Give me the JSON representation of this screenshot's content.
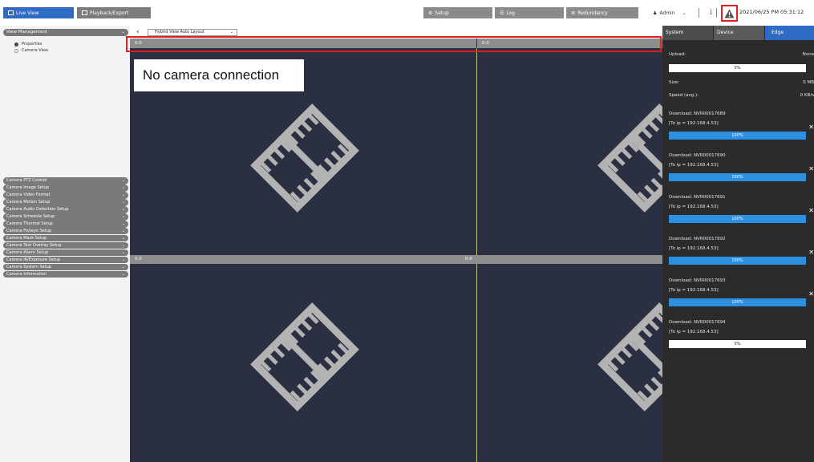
{
  "topbar": {
    "live_view": "Live View",
    "playback": "Playback/Export",
    "setup": "Setup",
    "log": "Log",
    "redundancy": "Redundancy",
    "admin": "Admin",
    "datetime": "2021/06/25 PM 05:31:12"
  },
  "sidebar": {
    "header": "View Management",
    "radios": [
      {
        "label": "Properties",
        "selected": true
      },
      {
        "label": "Camera View",
        "selected": false
      }
    ],
    "menu": [
      "Camera PTZ Control",
      "Camera Image Setup",
      "Camera Video Format",
      "Camera Motion Setup",
      "Camera Audio Detection Setup",
      "Camera Schedule Setup",
      "Camera Thermal Setup",
      "Camera Fisheye Setup",
      "Camera Mask Setup",
      "Camera Text Overlay Setup",
      "Camera Alarm Setup",
      "Camera IR/Exposure Setup",
      "Camera System Setup",
      "Camera Information"
    ]
  },
  "layout": {
    "selected": "Hybrid View Auto Layout"
  },
  "grid": {
    "cam1_title": "0.0",
    "cam2_title": "0.0",
    "cam3_title": "0.0",
    "cam4_title": "0.0",
    "no_connection": "No camera connection"
  },
  "right_panel": {
    "tabs": {
      "system": "System",
      "device": "Device",
      "edge": "Edge"
    },
    "upload_label": "Upload:",
    "upload_value": "None",
    "upload_progress": {
      "percent": 0,
      "text": "0%"
    },
    "size_label": "Size:",
    "size_value": "0 MB",
    "speed_label": "Speed (avg.):",
    "speed_value": "0 KB/s",
    "downloads": [
      {
        "title": "Download: NVR00017689",
        "ip": "[To ip = 192.168.4.53]",
        "percent": 100,
        "text": "100%"
      },
      {
        "title": "Download: NVR00017690",
        "ip": "[To ip = 192.168.4.53]",
        "percent": 100,
        "text": "100%"
      },
      {
        "title": "Download: NVR00017691",
        "ip": "[To ip = 192.168.4.53]",
        "percent": 100,
        "text": "100%"
      },
      {
        "title": "Download: NVR00017692",
        "ip": "[To ip = 192.168.4.53]",
        "percent": 100,
        "text": "100%"
      },
      {
        "title": "Download: NVR00017693",
        "ip": "[To ip = 192.168.4.53]",
        "percent": 100,
        "text": "100%"
      },
      {
        "title": "Download: NVR00017694",
        "ip": "[To ip = 192.168.4.53]",
        "percent": 0,
        "text": "0%"
      }
    ]
  },
  "colors": {
    "accent": "#2f6bc4",
    "grid_bg": "#2a2f42",
    "alert_border": "#e02020",
    "progress_fill": "#2d8fe0"
  }
}
